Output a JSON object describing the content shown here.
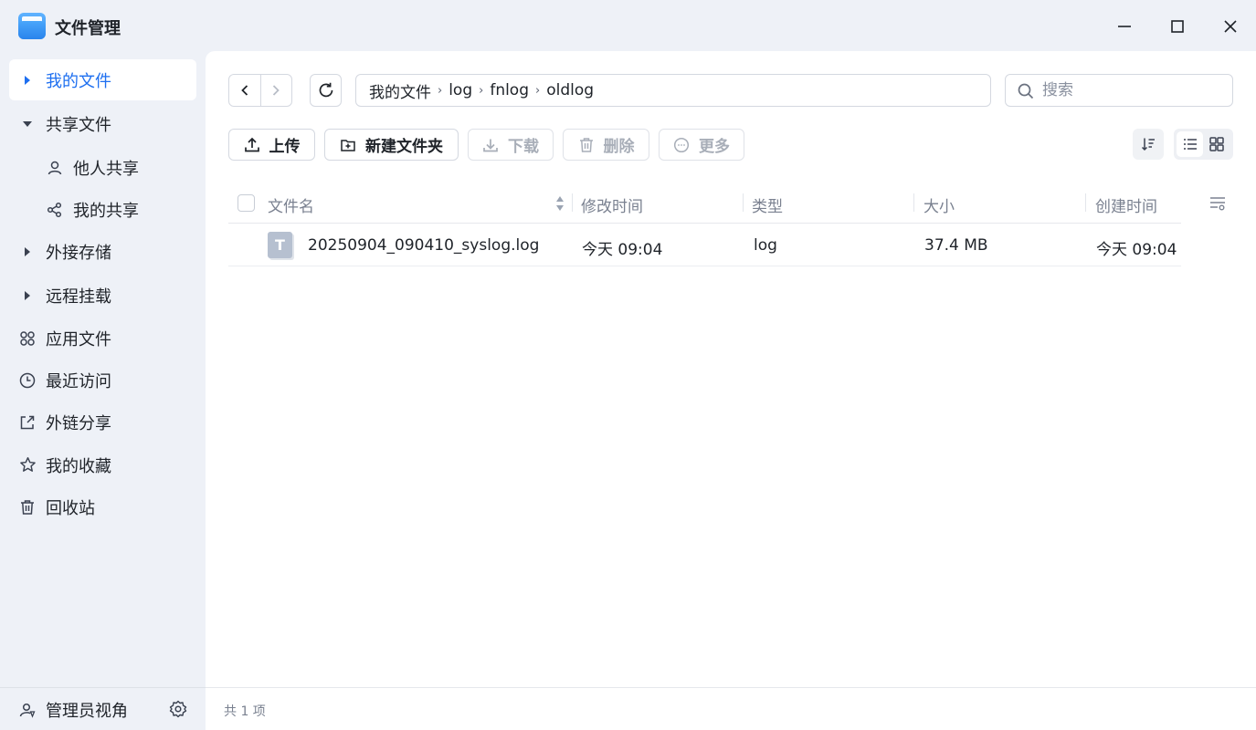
{
  "window": {
    "title": "文件管理",
    "controls": [
      "minimize",
      "maximize",
      "close"
    ]
  },
  "sidebar": {
    "items": [
      {
        "label": "我的文件",
        "icon": "caret-right-icon",
        "active": true
      },
      {
        "label": "共享文件",
        "icon": "caret-down-icon"
      },
      {
        "label": "他人共享",
        "icon": "user-icon",
        "sub": true
      },
      {
        "label": "我的共享",
        "icon": "share-icon",
        "sub": true
      },
      {
        "label": "外接存储",
        "icon": "caret-right-icon"
      },
      {
        "label": "远程挂载",
        "icon": "caret-right-icon"
      },
      {
        "label": "应用文件",
        "icon": "apps-icon"
      },
      {
        "label": "最近访问",
        "icon": "clock-icon"
      },
      {
        "label": "外链分享",
        "icon": "external-link-icon"
      },
      {
        "label": "我的收藏",
        "icon": "star-icon"
      },
      {
        "label": "回收站",
        "icon": "trash-icon"
      }
    ],
    "footer": {
      "label": "管理员视角",
      "icon": "admin-user-icon",
      "settings_icon": "gear-icon"
    }
  },
  "breadcrumb": [
    "我的文件",
    "log",
    "fnlog",
    "oldlog"
  ],
  "search": {
    "placeholder": "搜索",
    "value": ""
  },
  "toolbar": {
    "upload": "上传",
    "new_folder": "新建文件夹",
    "download": "下载",
    "delete": "删除",
    "more": "更多"
  },
  "table": {
    "headers": {
      "name": "文件名",
      "modified": "修改时间",
      "type": "类型",
      "size": "大小",
      "created": "创建时间"
    },
    "rows": [
      {
        "icon": "T",
        "name": "20250904_090410_syslog.log",
        "modified": "今天 09:04",
        "type": "log",
        "size": "37.4 MB",
        "created": "今天 09:04"
      }
    ]
  },
  "status": {
    "count_text": "共 1 项"
  },
  "colors": {
    "accent": "#1e6ff0",
    "sidebar_bg": "#eef1f7",
    "text": "#1f2329",
    "muted": "#7a8190"
  }
}
